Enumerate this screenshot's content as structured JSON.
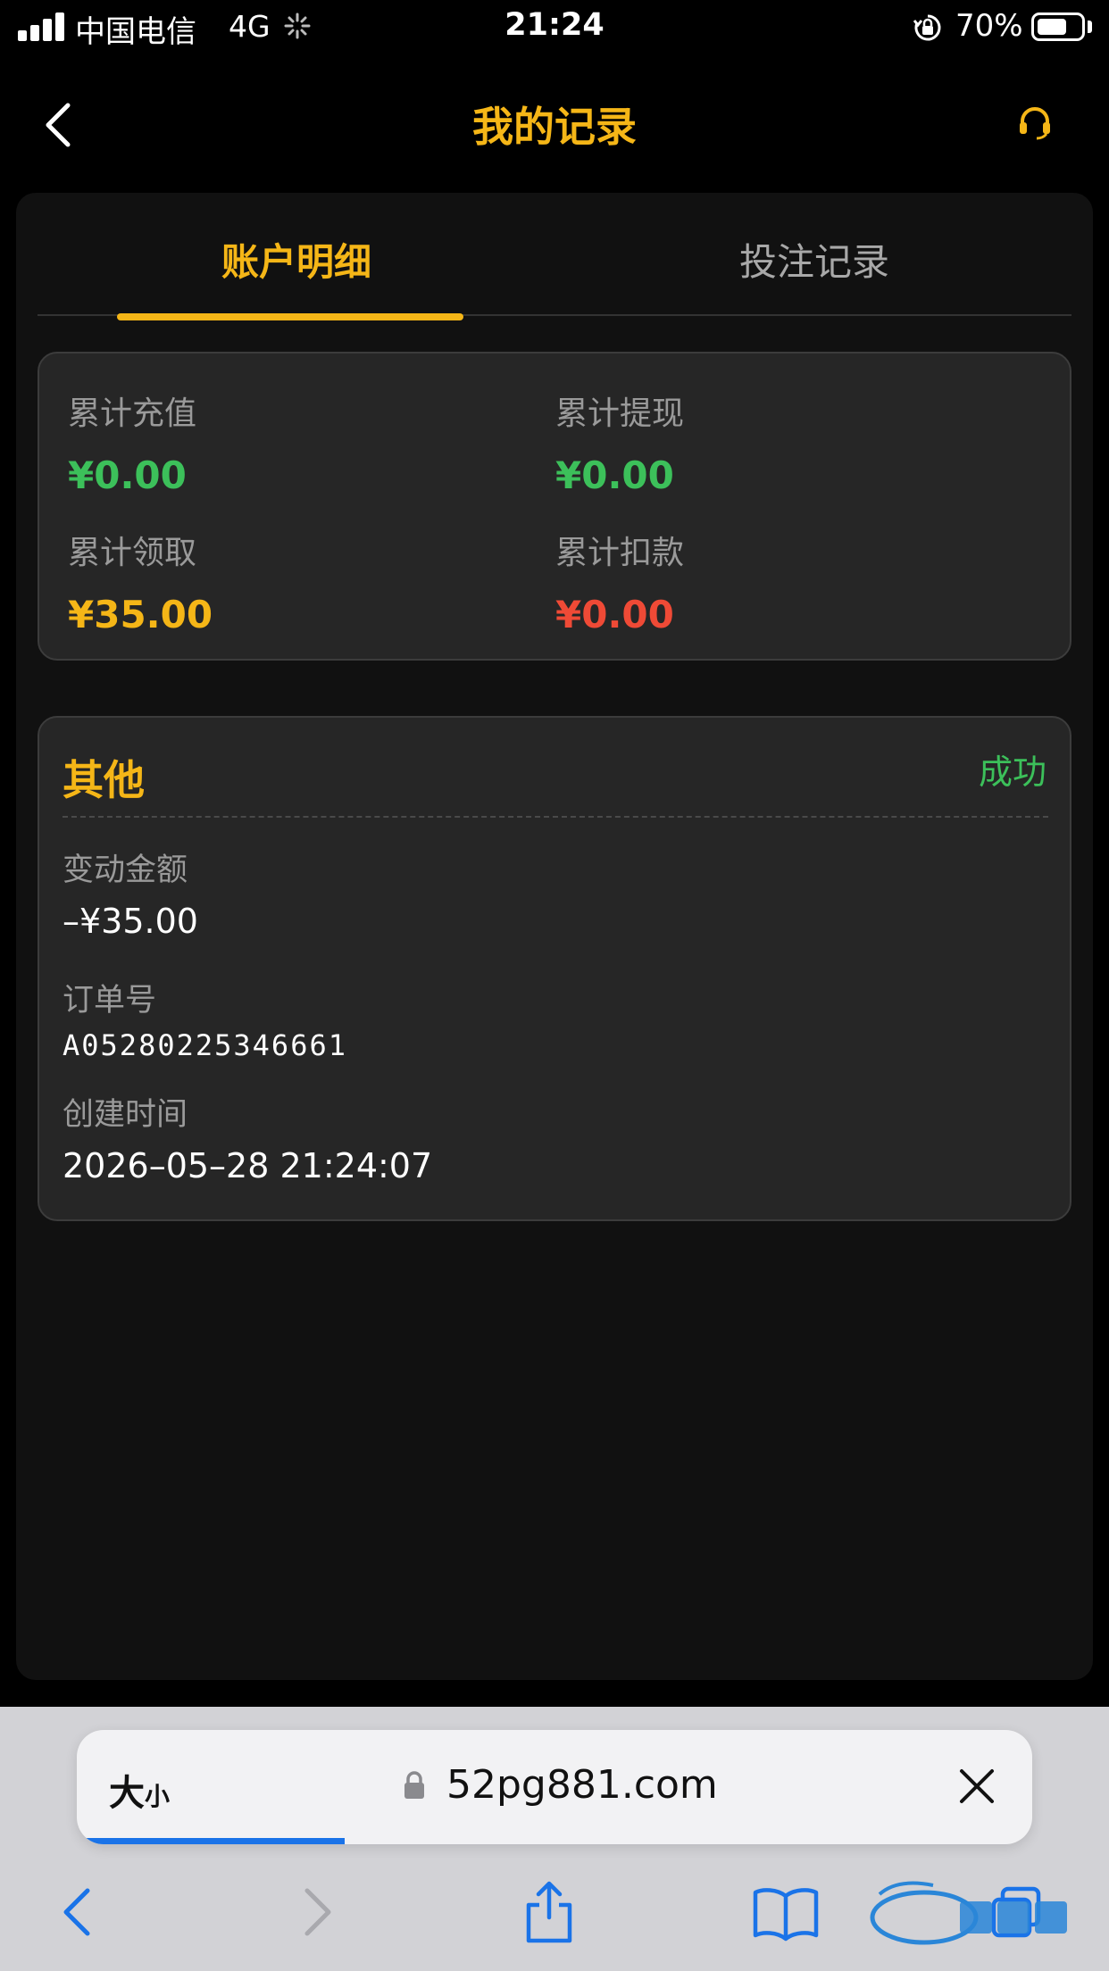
{
  "status_bar": {
    "carrier": "中国电信",
    "network": "4G",
    "time": "21:24",
    "battery_percent": "70%",
    "battery_level": 0.7
  },
  "nav": {
    "title": "我的记录",
    "back_icon": "chevron-left-icon",
    "support_icon": "headset-icon"
  },
  "tabs": [
    {
      "label": "账户明细",
      "active": true
    },
    {
      "label": "投注记录",
      "active": false
    }
  ],
  "summary": [
    {
      "label": "累计充值",
      "value": "¥0.00",
      "color": "#3cc05a"
    },
    {
      "label": "累计提现",
      "value": "¥0.00",
      "color": "#3cc05a"
    },
    {
      "label": "累计领取",
      "value": "¥35.00",
      "color": "#f5b617"
    },
    {
      "label": "累计扣款",
      "value": "¥0.00",
      "color": "#ef4a36"
    }
  ],
  "record": {
    "type": "其他",
    "status": "成功",
    "amount_label": "变动金额",
    "amount": "–¥35.00",
    "order_label": "订单号",
    "order_no": "A05280225346661",
    "time_label": "创建时间",
    "created_at": "2026–05–28 21:24:07"
  },
  "browser": {
    "text_size_label": "大",
    "text_size_small": "小",
    "url": "52pg881.com",
    "load_progress": 0.28,
    "toolbar_icons": [
      "back-icon",
      "forward-icon",
      "share-icon",
      "bookmarks-icon",
      "tabs-icon"
    ]
  },
  "colors": {
    "accent": "#f5b617",
    "success": "#3cc05a",
    "danger": "#ef4a36",
    "background": "#000000",
    "card": "#262626"
  }
}
